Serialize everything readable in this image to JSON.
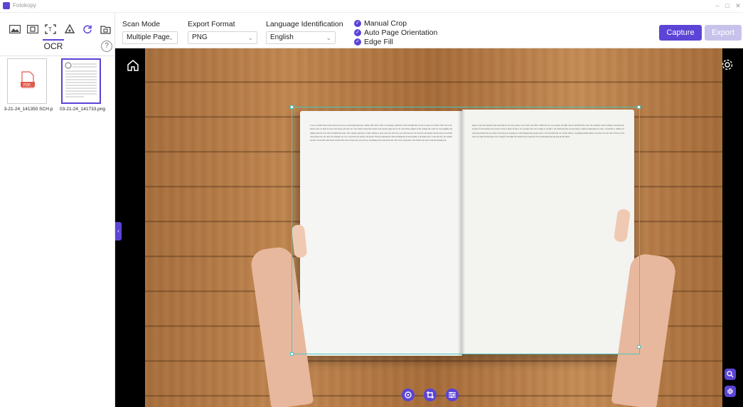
{
  "app": {
    "title": "Fotokopy"
  },
  "left_panel": {
    "tab_label": "OCR",
    "help_label": "?",
    "thumbnails": [
      {
        "name": "3-21-24_141350 SCH.p"
      },
      {
        "name": "03-21-24_141733.png"
      }
    ]
  },
  "toolbar": {
    "scan_mode": {
      "label": "Scan Mode",
      "value": "Multiple Page"
    },
    "export_format": {
      "label": "Export Format",
      "value": "PNG"
    },
    "language": {
      "label": "Language Identification",
      "value": "English"
    },
    "options": [
      {
        "label": "Manual Crop",
        "checked": true
      },
      {
        "label": "Auto Page Orientation",
        "checked": true
      },
      {
        "label": "Edge Fill",
        "checked": true
      }
    ],
    "capture_label": "Capture",
    "export_label": "Export"
  },
  "colors": {
    "accent": "#5b44d6",
    "crop": "#46c8c1",
    "export_disabled": "#c7c2ec"
  }
}
